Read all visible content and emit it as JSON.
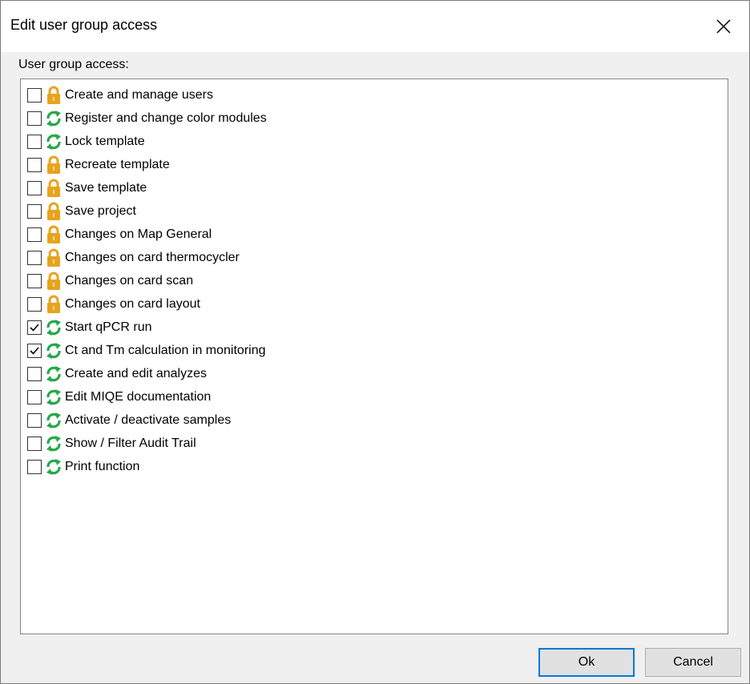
{
  "dialog": {
    "title": "Edit user group access",
    "group_label": "User group access:",
    "ok_label": "Ok",
    "cancel_label": "Cancel"
  },
  "items": [
    {
      "label": "Create and manage users",
      "checked": false,
      "icon": "lock-icon"
    },
    {
      "label": "Register and change color modules",
      "checked": false,
      "icon": "refresh-icon"
    },
    {
      "label": "Lock template",
      "checked": false,
      "icon": "refresh-icon"
    },
    {
      "label": "Recreate template",
      "checked": false,
      "icon": "lock-icon"
    },
    {
      "label": "Save template",
      "checked": false,
      "icon": "lock-icon"
    },
    {
      "label": "Save project",
      "checked": false,
      "icon": "lock-icon"
    },
    {
      "label": "Changes on Map General",
      "checked": false,
      "icon": "lock-icon"
    },
    {
      "label": "Changes on card thermocycler",
      "checked": false,
      "icon": "lock-icon"
    },
    {
      "label": "Changes on card scan",
      "checked": false,
      "icon": "lock-icon"
    },
    {
      "label": "Changes on card layout",
      "checked": false,
      "icon": "lock-icon"
    },
    {
      "label": "Start qPCR run",
      "checked": true,
      "icon": "refresh-icon"
    },
    {
      "label": "Ct and Tm calculation in monitoring",
      "checked": true,
      "icon": "refresh-icon"
    },
    {
      "label": "Create and edit analyzes",
      "checked": false,
      "icon": "refresh-icon"
    },
    {
      "label": "Edit MIQE documentation",
      "checked": false,
      "icon": "refresh-icon"
    },
    {
      "label": "Activate / deactivate samples",
      "checked": false,
      "icon": "refresh-icon"
    },
    {
      "label": "Show / Filter Audit Trail",
      "checked": false,
      "icon": "refresh-icon"
    },
    {
      "label": "Print function",
      "checked": false,
      "icon": "refresh-icon"
    }
  ],
  "colors": {
    "lock": "#e8a31c",
    "refresh": "#27a74a",
    "accent": "#0078d7"
  }
}
